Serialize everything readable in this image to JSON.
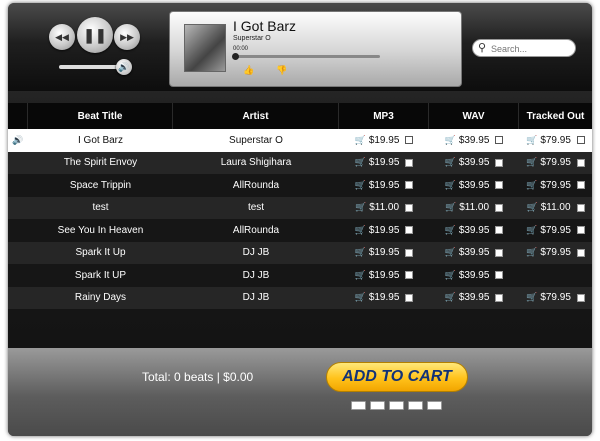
{
  "player": {
    "now_playing_title": "I Got Barz",
    "now_playing_artist": "Superstar O",
    "time": "00:00"
  },
  "search": {
    "placeholder": "Search..."
  },
  "table": {
    "headers": [
      "Beat Title",
      "Artist",
      "MP3",
      "WAV",
      "Tracked Out"
    ],
    "rows": [
      {
        "title": "I Got Barz",
        "artist": "Superstar O",
        "mp3": "$19.95",
        "wav": "$39.95",
        "tracked": "$79.95",
        "active": true
      },
      {
        "title": "The Spirit Envoy",
        "artist": "Laura Shigihara",
        "mp3": "$19.95",
        "wav": "$39.95",
        "tracked": "$79.95"
      },
      {
        "title": "Space Trippin",
        "artist": "AllRounda",
        "mp3": "$19.95",
        "wav": "$39.95",
        "tracked": "$79.95"
      },
      {
        "title": "test",
        "artist": "test",
        "mp3": "$11.00",
        "wav": "$11.00",
        "tracked": "$11.00"
      },
      {
        "title": "See You In Heaven",
        "artist": "AllRounda",
        "mp3": "$19.95",
        "wav": "$39.95",
        "tracked": "$79.95"
      },
      {
        "title": "Spark It Up",
        "artist": "DJ JB",
        "mp3": "$19.95",
        "wav": "$39.95",
        "tracked": "$79.95"
      },
      {
        "title": "Spark It UP",
        "artist": "DJ JB",
        "mp3": "$19.95",
        "wav": "$39.95",
        "tracked": ""
      },
      {
        "title": "Rainy Days",
        "artist": "DJ JB",
        "mp3": "$19.95",
        "wav": "$39.95",
        "tracked": "$79.95"
      }
    ]
  },
  "footer": {
    "total": "Total: 0 beats | $0.00",
    "add_to_cart": "ADD TO CART"
  },
  "colors": {
    "accent": "#ffc21a",
    "button_text": "#123278"
  }
}
